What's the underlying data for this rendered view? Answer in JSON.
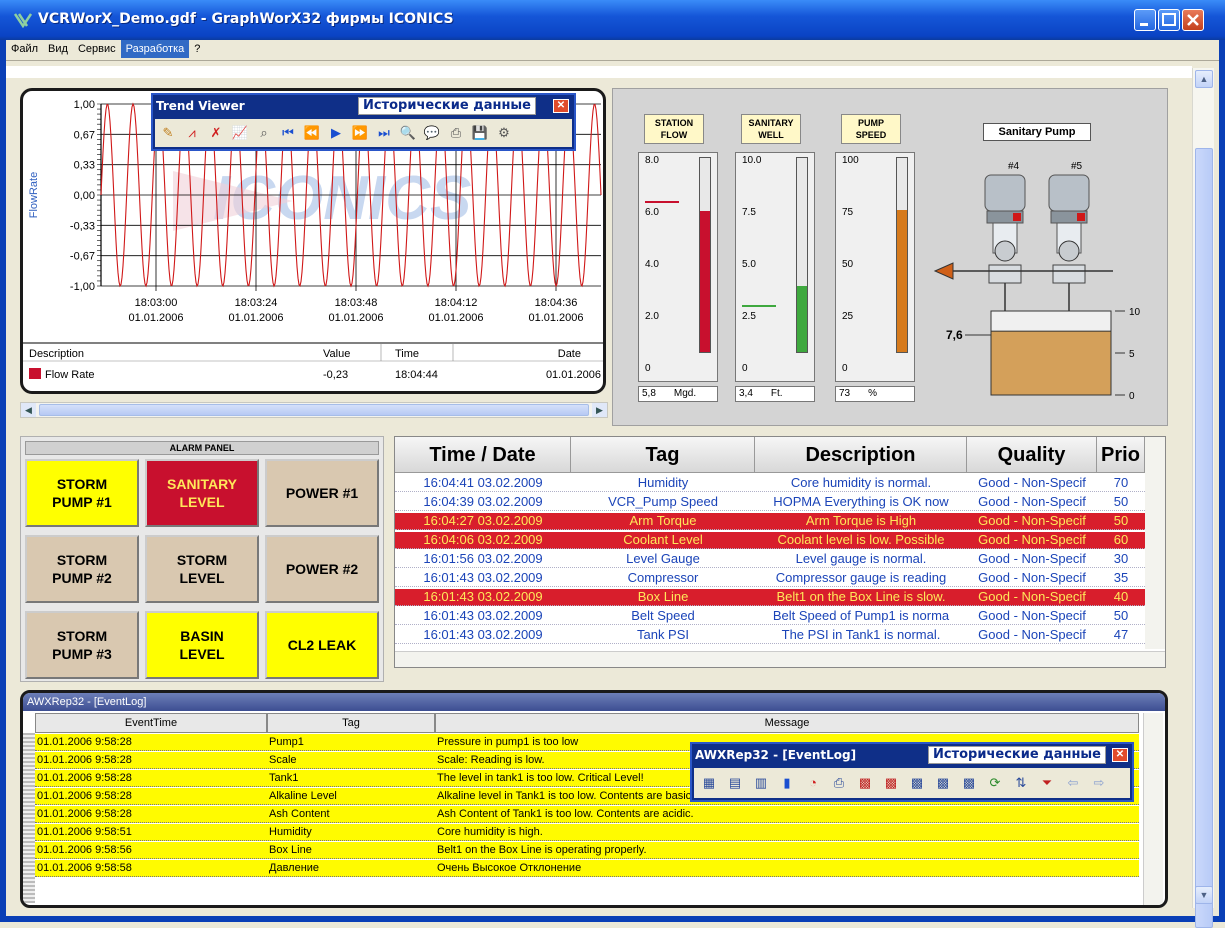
{
  "window": {
    "title": "VCRWorX_Demo.gdf - GraphWorX32 фирмы ICONICS"
  },
  "menu": [
    "Файл",
    "Вид",
    "Сервис",
    "Разработка",
    "?"
  ],
  "trend": {
    "y_axis_label": "FlowRate",
    "y_ticks": [
      "1,00",
      "0,67",
      "0,33",
      "0,00",
      "-0,33",
      "-0,67",
      "-1,00"
    ],
    "x_ticks": [
      {
        "time": "18:03:00",
        "date": "01.01.2006"
      },
      {
        "time": "18:03:24",
        "date": "01.01.2006"
      },
      {
        "time": "18:03:48",
        "date": "01.01.2006"
      },
      {
        "time": "18:04:12",
        "date": "01.01.2006"
      },
      {
        "time": "18:04:36",
        "date": "01.01.2006"
      }
    ],
    "watermark": "ICONICS",
    "legend_headers": {
      "description": "Description",
      "value": "Value",
      "time": "Time",
      "date": "Date"
    },
    "legend_row": {
      "description": "Flow Rate",
      "value": "-0,23",
      "time": "18:04:44",
      "date": "01.01.2006",
      "color": "#c8102e"
    }
  },
  "trend_viewer": {
    "title": "Trend Viewer",
    "mode": "Исторические данные",
    "tools": [
      "pen-add",
      "trend",
      "trend-remove",
      "chart",
      "zoom-trend",
      "first",
      "prev-page",
      "play",
      "next-page",
      "last",
      "zoom",
      "comment",
      "print",
      "save",
      "settings"
    ]
  },
  "gauges": [
    {
      "label1": "STATION",
      "label2": "FLOW",
      "ticks": [
        "8.0",
        "6.0",
        "4.0",
        "2.0",
        "0"
      ],
      "fill": 0.725,
      "color": "#c8102e",
      "value": "5,8",
      "unit": "Mgd."
    },
    {
      "label1": "SANITARY",
      "label2": "WELL",
      "ticks": [
        "10.0",
        "7.5",
        "5.0",
        "2.5",
        "0"
      ],
      "fill": 0.34,
      "color": "#3ea83e",
      "value": "3,4",
      "unit": "Ft."
    },
    {
      "label1": "PUMP",
      "label2": "SPEED",
      "ticks": [
        "100",
        "75",
        "50",
        "25",
        "0"
      ],
      "fill": 0.73,
      "color": "#d67a1c",
      "value": "73",
      "unit": "%"
    }
  ],
  "pump": {
    "title": "Sanitary Pump",
    "pump_a": "#4",
    "pump_b": "#5",
    "tank_level": "7,6",
    "tank_fill": 0.76,
    "tank_ticks": [
      "10",
      "5",
      "0"
    ]
  },
  "alarm_panel": {
    "header": "ALARM PANEL",
    "buttons": [
      {
        "line1": "STORM",
        "line2": "PUMP #1",
        "state": "warn"
      },
      {
        "line1": "SANITARY",
        "line2": "LEVEL",
        "state": "alarm"
      },
      {
        "line1": "POWER #1",
        "line2": "",
        "state": "normal"
      },
      {
        "line1": "STORM",
        "line2": "PUMP #2",
        "state": "normal"
      },
      {
        "line1": "STORM",
        "line2": "LEVEL",
        "state": "normal"
      },
      {
        "line1": "POWER #2",
        "line2": "",
        "state": "normal"
      },
      {
        "line1": "STORM",
        "line2": "PUMP #3",
        "state": "normal"
      },
      {
        "line1": "BASIN",
        "line2": "LEVEL",
        "state": "warn"
      },
      {
        "line1": "CL2 LEAK",
        "line2": "",
        "state": "warn"
      }
    ],
    "colors": {
      "warn": "#ffff00",
      "alarm": "#c8102e",
      "normal": "#d9c8b0"
    }
  },
  "alarm_grid": {
    "headers": [
      "Time / Date",
      "Tag",
      "Description",
      "Quality",
      "Prio"
    ],
    "rows": [
      {
        "time": "16:04:41",
        "date": "03.02.2009",
        "tag": "Humidity",
        "desc": "Core humidity is normal.",
        "quality": "Good - Non-Specif",
        "prio": "70",
        "alarm": false
      },
      {
        "time": "16:04:39",
        "date": "03.02.2009",
        "tag": "VCR_Pump Speed",
        "desc": "НОРМА Everything is OK now",
        "quality": "Good - Non-Specif",
        "prio": "50",
        "alarm": false
      },
      {
        "time": "16:04:27",
        "date": "03.02.2009",
        "tag": "Arm Torque",
        "desc": "Arm Torque is High",
        "quality": "Good - Non-Specif",
        "prio": "50",
        "alarm": true
      },
      {
        "time": "16:04:06",
        "date": "03.02.2009",
        "tag": "Coolant Level",
        "desc": "Coolant level is low.  Possible",
        "quality": "Good - Non-Specif",
        "prio": "60",
        "alarm": true
      },
      {
        "time": "16:01:56",
        "date": "03.02.2009",
        "tag": "Level Gauge",
        "desc": "Level gauge is normal.",
        "quality": "Good - Non-Specif",
        "prio": "30",
        "alarm": false
      },
      {
        "time": "16:01:43",
        "date": "03.02.2009",
        "tag": "Compressor",
        "desc": "Compressor gauge is reading",
        "quality": "Good - Non-Specif",
        "prio": "35",
        "alarm": false
      },
      {
        "time": "16:01:43",
        "date": "03.02.2009",
        "tag": "Box Line",
        "desc": "Belt1 on the Box Line is slow.",
        "quality": "Good - Non-Specif",
        "prio": "40",
        "alarm": true
      },
      {
        "time": "16:01:43",
        "date": "03.02.2009",
        "tag": "Belt Speed",
        "desc": "Belt Speed of Pump1 is norma",
        "quality": "Good - Non-Specif",
        "prio": "50",
        "alarm": false
      },
      {
        "time": "16:01:43",
        "date": "03.02.2009",
        "tag": "Tank PSI",
        "desc": "The PSI in Tank1 is normal.",
        "quality": "Good - Non-Specif",
        "prio": "47",
        "alarm": false
      }
    ]
  },
  "event_log": {
    "title": "AWXRep32 - [EventLog]",
    "headers": [
      "EventTime",
      "Tag",
      "Message"
    ],
    "rows": [
      {
        "time": "01.01.2006 9:58:28",
        "tag": "Pump1",
        "message": "Pressure in pump1 is too low"
      },
      {
        "time": "01.01.2006 9:58:28",
        "tag": "Scale",
        "message": "Scale:  Reading is low."
      },
      {
        "time": "01.01.2006 9:58:28",
        "tag": "Tank1",
        "message": "The level in tank1 is too low. Critical Level!"
      },
      {
        "time": "01.01.2006 9:58:28",
        "tag": "Alkaline Level",
        "message": "Alkaline level in Tank1 is too low.  Contents are basic"
      },
      {
        "time": "01.01.2006 9:58:28",
        "tag": "Ash Content",
        "message": "Ash Content of Tank1 is too low.  Contents are acidic."
      },
      {
        "time": "01.01.2006 9:58:51",
        "tag": "Humidity",
        "message": "Core humidity is high."
      },
      {
        "time": "01.01.2006 9:58:56",
        "tag": "Box Line",
        "message": "Belt1 on the Box Line is operating properly."
      },
      {
        "time": "01.01.2006 9:58:58",
        "tag": "Давление",
        "message": " Очень Высокое Отклонение"
      }
    ]
  },
  "report_toolbar": {
    "title": "AWXRep32 - [EventLog]",
    "mode": "Исторические данные",
    "tools": [
      "table",
      "grid",
      "columns",
      "bar-chart",
      "pie-chart",
      "print",
      "filter-a",
      "filter-b",
      "filter-c",
      "filter-d",
      "filter-e",
      "refresh",
      "sort",
      "funnel",
      "back",
      "forward"
    ]
  }
}
